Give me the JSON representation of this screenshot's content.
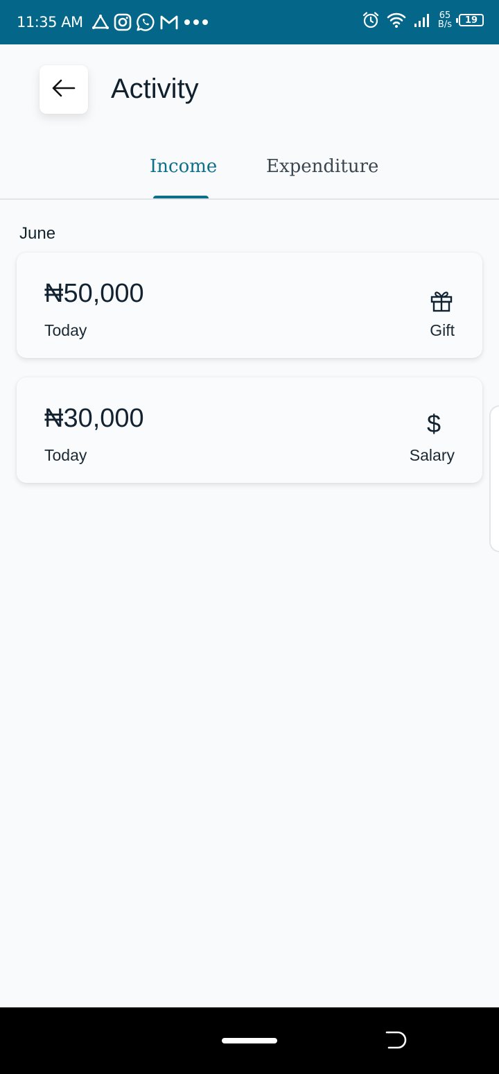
{
  "status_bar": {
    "time": "11:35 AM",
    "left_icons": [
      "drive-icon",
      "instagram-icon",
      "whatsapp-icon",
      "gmail-icon",
      "more-notifications-icon"
    ],
    "right_icons": [
      "alarm-icon",
      "wifi-icon",
      "signal-icon"
    ],
    "network_speed_value": "65",
    "network_speed_unit": "B/s",
    "battery_level": "19",
    "background_color": "#046789"
  },
  "header": {
    "back_icon": "arrow-left-icon",
    "title": "Activity"
  },
  "tabs": [
    {
      "label": "Income",
      "active": true
    },
    {
      "label": "Expenditure",
      "active": false
    }
  ],
  "accent_color": "#0d6f89",
  "section": {
    "label": "June",
    "transactions": [
      {
        "amount": "₦50,000",
        "date": "Today",
        "category": "Gift",
        "icon": "gift-icon"
      },
      {
        "amount": "₦30,000",
        "date": "Today",
        "category": "Salary",
        "icon": "dollar-icon",
        "icon_glyph": "$"
      }
    ]
  },
  "nav_bar": {
    "home_indicator": "home-pill",
    "back_icon": "back-gesture-icon"
  }
}
